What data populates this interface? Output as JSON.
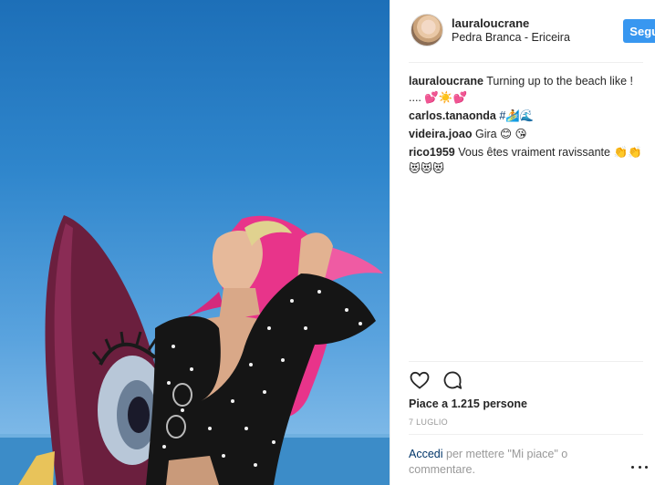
{
  "post": {
    "username": "lauraloucrane",
    "location": "Pedra Branca - Ericeira",
    "follow_label": "Segui"
  },
  "comments": [
    {
      "user": "lauraloucrane",
      "text": "Turning up to the beach like ! .... 💕☀️💕"
    },
    {
      "user": "carlos.tanaonda",
      "text": "#🏄🌊"
    },
    {
      "user": "videira.joao",
      "text": "Gira 😊 😘"
    },
    {
      "user": "rico1959",
      "text": "Vous êtes vraiment ravissante 👏👏😻😻😻"
    }
  ],
  "stats": {
    "likes": "Piace a 1.215 persone",
    "date": "7 LUGLIO"
  },
  "login": {
    "link": "Accedi",
    "text": " per mettere \"Mi piace\" o commentare."
  },
  "icons": {
    "like": "heart-icon",
    "comment": "comment-bubble-icon",
    "more": "more-options-icon"
  },
  "colors": {
    "accent": "#3897f0",
    "link": "#003569",
    "muted": "#999999"
  }
}
